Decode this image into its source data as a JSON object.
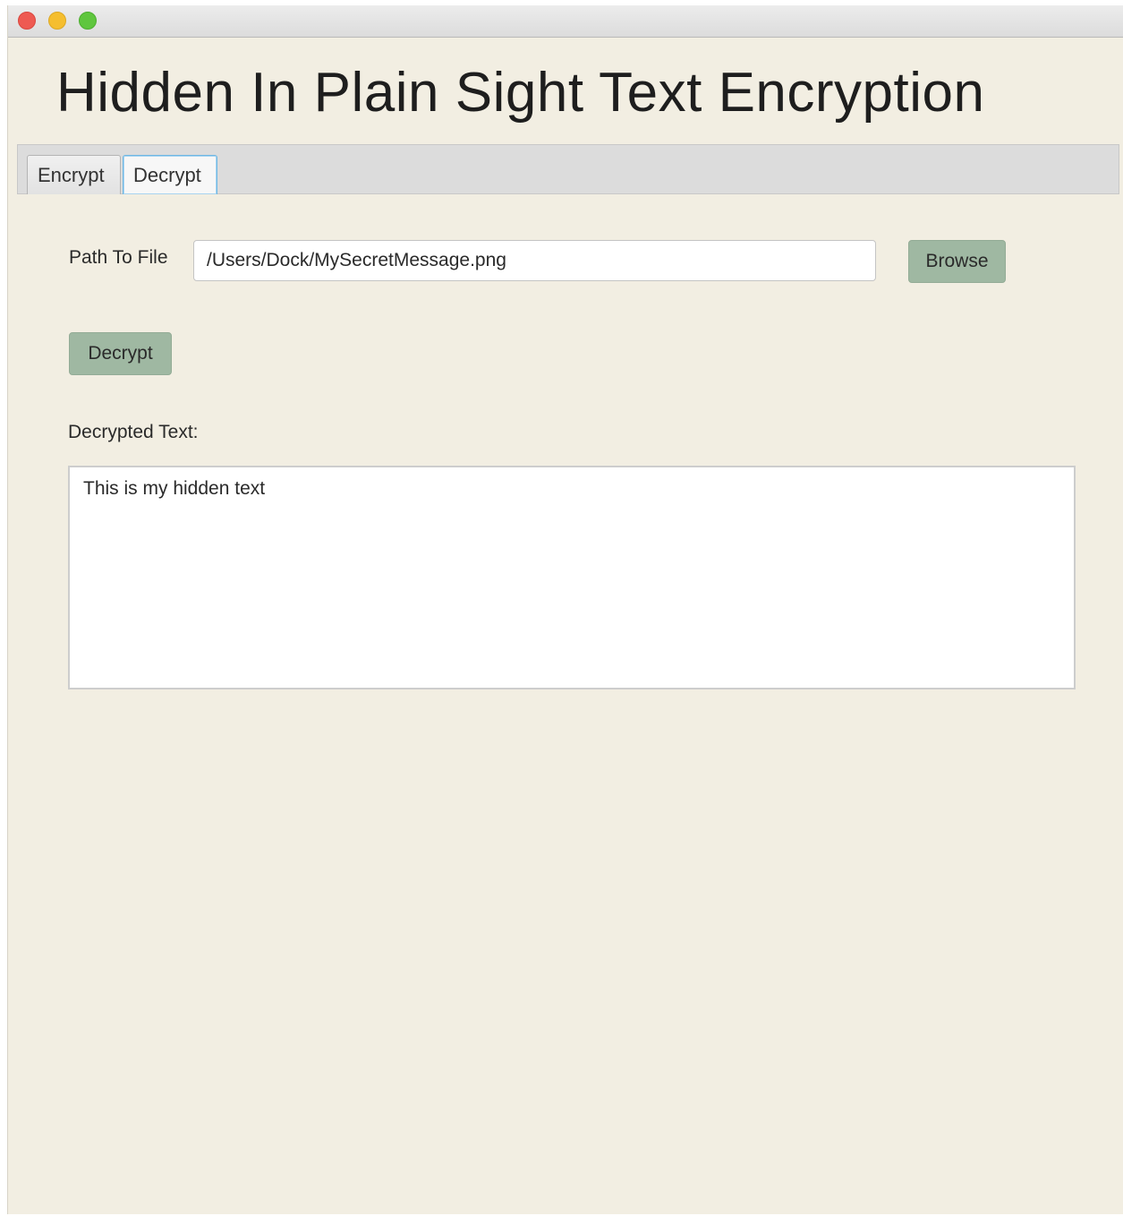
{
  "window": {
    "title": "",
    "controls": {
      "close_icon": "close-traffic-light",
      "minimize_icon": "minimize-traffic-light",
      "zoom_icon": "zoom-traffic-light",
      "close_color": "#ee5a52",
      "minimize_color": "#f5be2f",
      "zoom_color": "#5fc63e"
    }
  },
  "app": {
    "title": "Hidden In Plain Sight Text Encryption"
  },
  "tabs": [
    {
      "label": "Encrypt",
      "selected": false
    },
    {
      "label": "Decrypt",
      "selected": true
    }
  ],
  "decrypt_panel": {
    "path_label": "Path To File",
    "path_value": "/Users/Dock/MySecretMessage.png",
    "browse_label": "Browse",
    "decrypt_label": "Decrypt",
    "decrypted_text_label": "Decrypted Text:",
    "decrypted_text_value": "This is my hidden text"
  },
  "colors": {
    "background": "#f2eee2",
    "button": "#9fb8a2",
    "selected_tab_border": "#6fb7e3"
  }
}
